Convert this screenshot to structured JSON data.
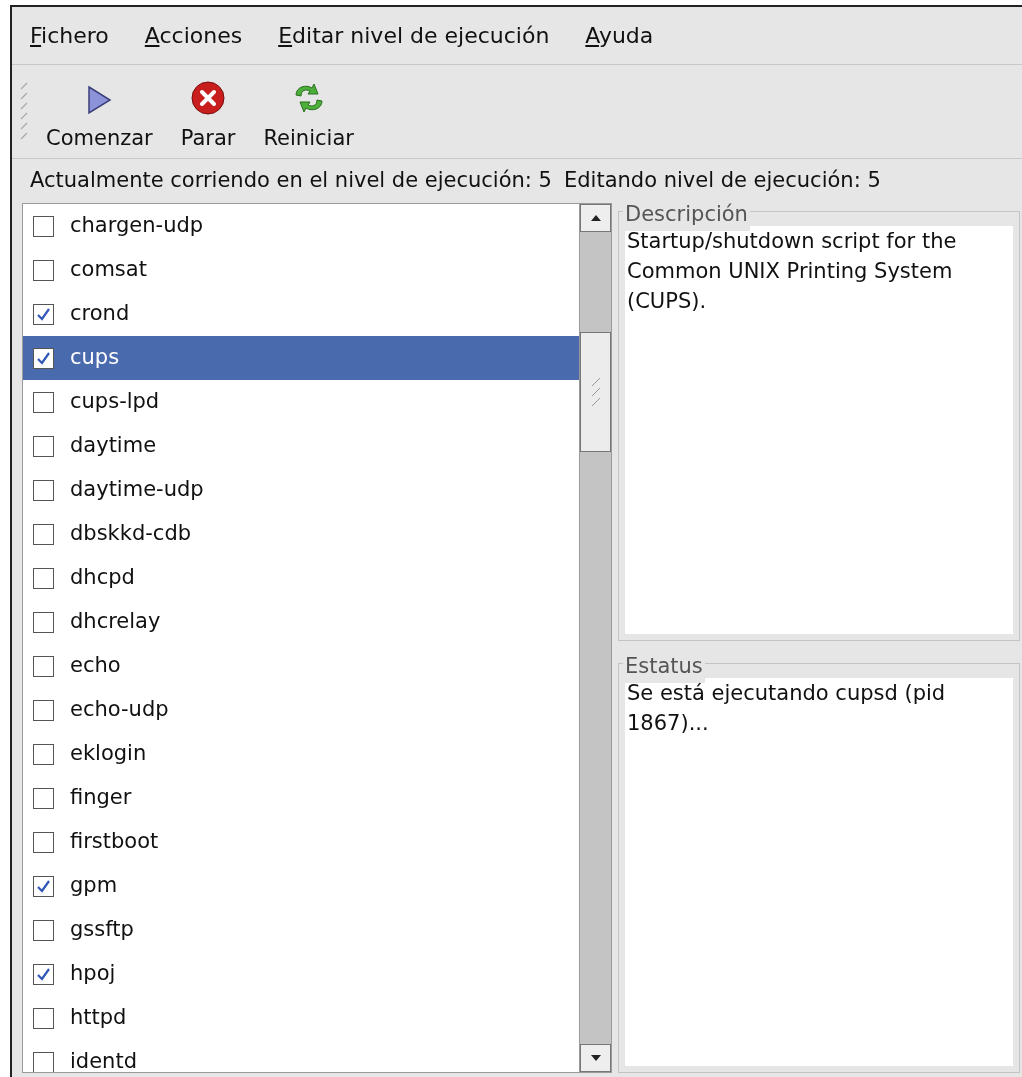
{
  "menu": [
    "Fichero",
    "Acciones",
    "Editar nivel de ejecución",
    "Ayuda"
  ],
  "toolbar": [
    {
      "kind": "start",
      "label": "Comenzar"
    },
    {
      "kind": "stop",
      "label": "Parar"
    },
    {
      "kind": "restart",
      "label": "Reiniciar"
    }
  ],
  "runlevel_current": "Actualmente corriendo en el nivel de ejecución: 5",
  "runlevel_editing": "Editando nivel de ejecución: 5",
  "services": [
    {
      "name": "chargen-udp",
      "checked": false,
      "selected": false
    },
    {
      "name": "comsat",
      "checked": false,
      "selected": false
    },
    {
      "name": "crond",
      "checked": true,
      "selected": false
    },
    {
      "name": "cups",
      "checked": true,
      "selected": true
    },
    {
      "name": "cups-lpd",
      "checked": false,
      "selected": false
    },
    {
      "name": "daytime",
      "checked": false,
      "selected": false
    },
    {
      "name": "daytime-udp",
      "checked": false,
      "selected": false
    },
    {
      "name": "dbskkd-cdb",
      "checked": false,
      "selected": false
    },
    {
      "name": "dhcpd",
      "checked": false,
      "selected": false
    },
    {
      "name": "dhcrelay",
      "checked": false,
      "selected": false
    },
    {
      "name": "echo",
      "checked": false,
      "selected": false
    },
    {
      "name": "echo-udp",
      "checked": false,
      "selected": false
    },
    {
      "name": "eklogin",
      "checked": false,
      "selected": false
    },
    {
      "name": "finger",
      "checked": false,
      "selected": false
    },
    {
      "name": "firstboot",
      "checked": false,
      "selected": false
    },
    {
      "name": "gpm",
      "checked": true,
      "selected": false
    },
    {
      "name": "gssftp",
      "checked": false,
      "selected": false
    },
    {
      "name": "hpoj",
      "checked": true,
      "selected": false
    },
    {
      "name": "httpd",
      "checked": false,
      "selected": false
    },
    {
      "name": "identd",
      "checked": false,
      "selected": false
    }
  ],
  "description": {
    "title": "Descripción",
    "text": "Startup/shutdown script for the Common UNIX Printing System (CUPS)."
  },
  "status": {
    "title": "Estatus",
    "text": "Se está ejecutando cupsd (pid 1867)..."
  }
}
